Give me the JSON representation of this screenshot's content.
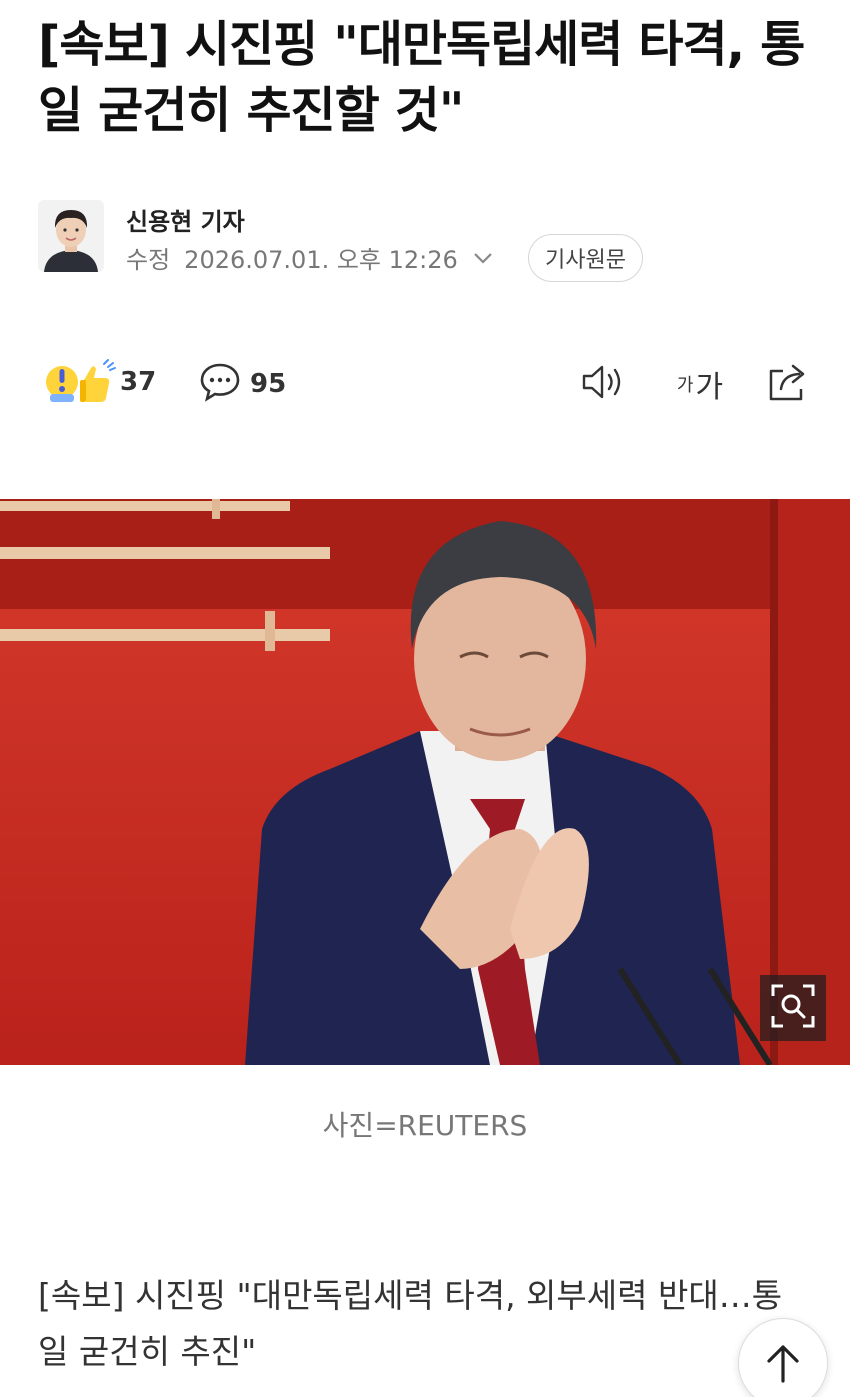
{
  "article": {
    "headline": "[속보] 시진핑 \"대만독립세력 타격, 통일 굳건히 추진할 것\"",
    "reporter": "신용현 기자",
    "modified_label": "수정",
    "modified_datetime": "2026.07.01. 오후 12:26",
    "original_button": "기사원문"
  },
  "actions": {
    "reaction_count": "37",
    "comment_count": "95",
    "font_size_label_small": "가",
    "font_size_label_large": "가"
  },
  "photo": {
    "caption": "사진=REUTERS"
  },
  "body": {
    "lead": "[속보] 시진핑 \"대만독립세력 타격, 외부세력 반대…통일 굳건히 추진\""
  },
  "icons": {
    "reaction": "reaction-emoji-icon",
    "comment": "speech-bubble-icon",
    "audio": "speaker-icon",
    "share": "share-icon",
    "zoom": "zoom-icon",
    "top": "arrow-up-icon",
    "chevron": "chevron-down-icon"
  },
  "colors": {
    "photo_background": "#c2241c",
    "text_primary": "#111111",
    "text_secondary": "#777777"
  }
}
